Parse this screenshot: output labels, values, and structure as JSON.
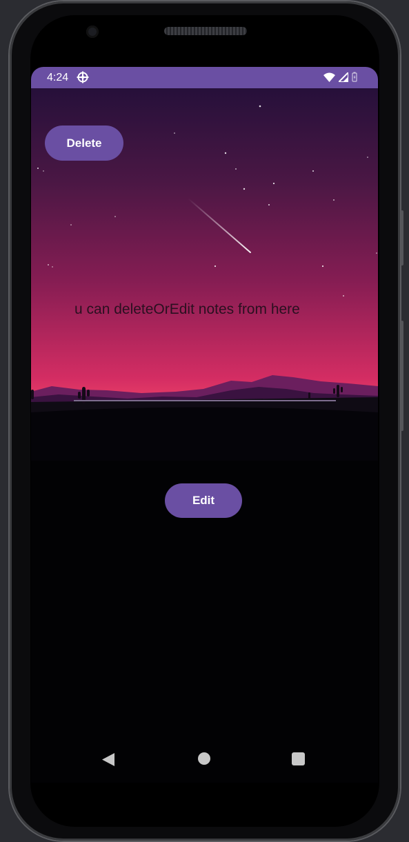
{
  "status_bar": {
    "time": "4:24",
    "settings_icon": "gear-icon",
    "wifi_icon": "wifi-icon",
    "signal_icon": "signal-icon",
    "battery_icon": "battery-icon"
  },
  "main": {
    "delete_label": "Delete",
    "hint": "u can deleteOrEdit notes from here",
    "note_value": "",
    "note_placeholder": "",
    "edit_label": "Edit"
  },
  "nav_bar": {
    "back_icon": "back-triangle-icon",
    "home_icon": "home-circle-icon",
    "recents_icon": "recents-square-icon"
  },
  "colors": {
    "accent": "#6a4fa3",
    "background": "#020204"
  }
}
